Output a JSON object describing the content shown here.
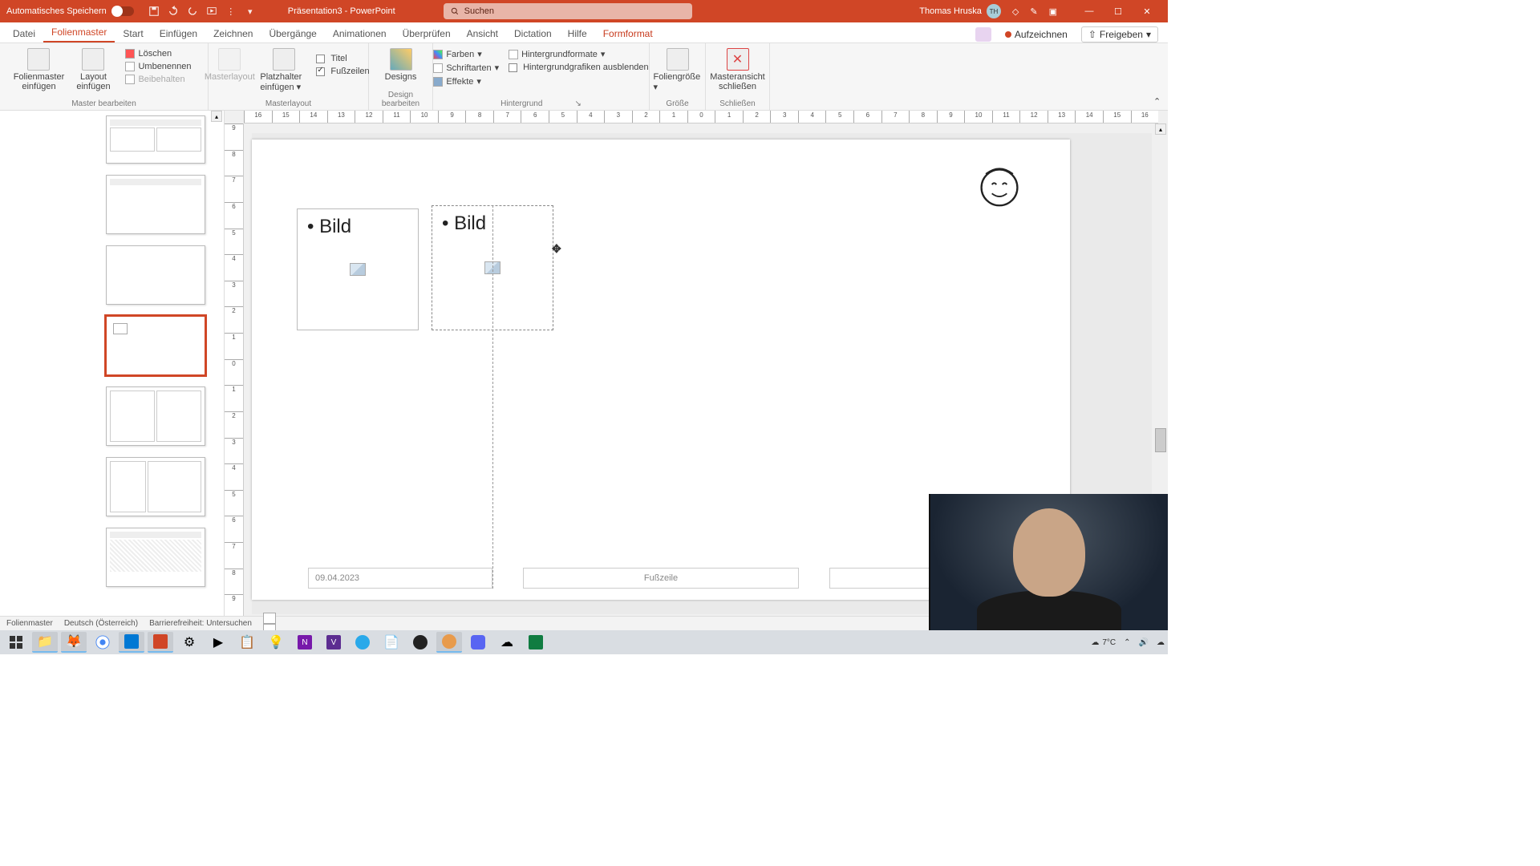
{
  "title_bar": {
    "auto_save": "Automatisches Speichern",
    "doc_title": "Präsentation3 - PowerPoint",
    "search_placeholder": "Suchen",
    "user_name": "Thomas Hruska",
    "user_initials": "TH"
  },
  "tabs": {
    "datei": "Datei",
    "folienmaster": "Folienmaster",
    "start": "Start",
    "einfuegen": "Einfügen",
    "zeichnen": "Zeichnen",
    "uebergaenge": "Übergänge",
    "animationen": "Animationen",
    "ueberpruefen": "Überprüfen",
    "ansicht": "Ansicht",
    "dictation": "Dictation",
    "hilfe": "Hilfe",
    "formformat": "Formformat",
    "aufzeichnen": "Aufzeichnen",
    "freigeben": "Freigeben"
  },
  "ribbon": {
    "master_bearbeiten": "Master bearbeiten",
    "folienmaster_einfuegen": "Folienmaster einfügen",
    "layout_einfuegen": "Layout einfügen",
    "loeschen": "Löschen",
    "umbenennen": "Umbenennen",
    "beibehalten": "Beibehalten",
    "masterlayout_group": "Masterlayout",
    "masterlayout_btn": "Masterlayout",
    "platzhalter_einfuegen": "Platzhalter einfügen",
    "titel": "Titel",
    "fusszeilen": "Fußzeilen",
    "design_bearbeiten": "Design bearbeiten",
    "designs": "Designs",
    "hintergrund": "Hintergrund",
    "farben": "Farben",
    "schriftarten": "Schriftarten",
    "effekte": "Effekte",
    "hintergrundformate": "Hintergrundformate",
    "hintergrundgrafiken_ausblenden": "Hintergrundgrafiken ausblenden",
    "groesse": "Größe",
    "foliengroesse": "Foliengröße",
    "schliessen": "Schließen",
    "masteransicht_schliessen": "Masteransicht schließen"
  },
  "slide": {
    "bild1": "Bild",
    "bild2": "Bild",
    "date": "09.04.2023",
    "fusszeile": "Fußzeile"
  },
  "statusbar": {
    "folienmaster": "Folienmaster",
    "language": "Deutsch (Österreich)",
    "accessibility": "Barrierefreiheit: Untersuchen"
  },
  "taskbar": {
    "temp": "7°C"
  },
  "ruler_h": [
    "16",
    "15",
    "14",
    "13",
    "12",
    "11",
    "10",
    "9",
    "8",
    "7",
    "6",
    "5",
    "4",
    "3",
    "2",
    "1",
    "0",
    "1",
    "2",
    "3",
    "4",
    "5",
    "6",
    "7",
    "8",
    "9",
    "10",
    "11",
    "12",
    "13",
    "14",
    "15",
    "16"
  ],
  "ruler_v": [
    "9",
    "8",
    "7",
    "6",
    "5",
    "4",
    "3",
    "2",
    "1",
    "0",
    "1",
    "2",
    "3",
    "4",
    "5",
    "6",
    "7",
    "8",
    "9"
  ]
}
